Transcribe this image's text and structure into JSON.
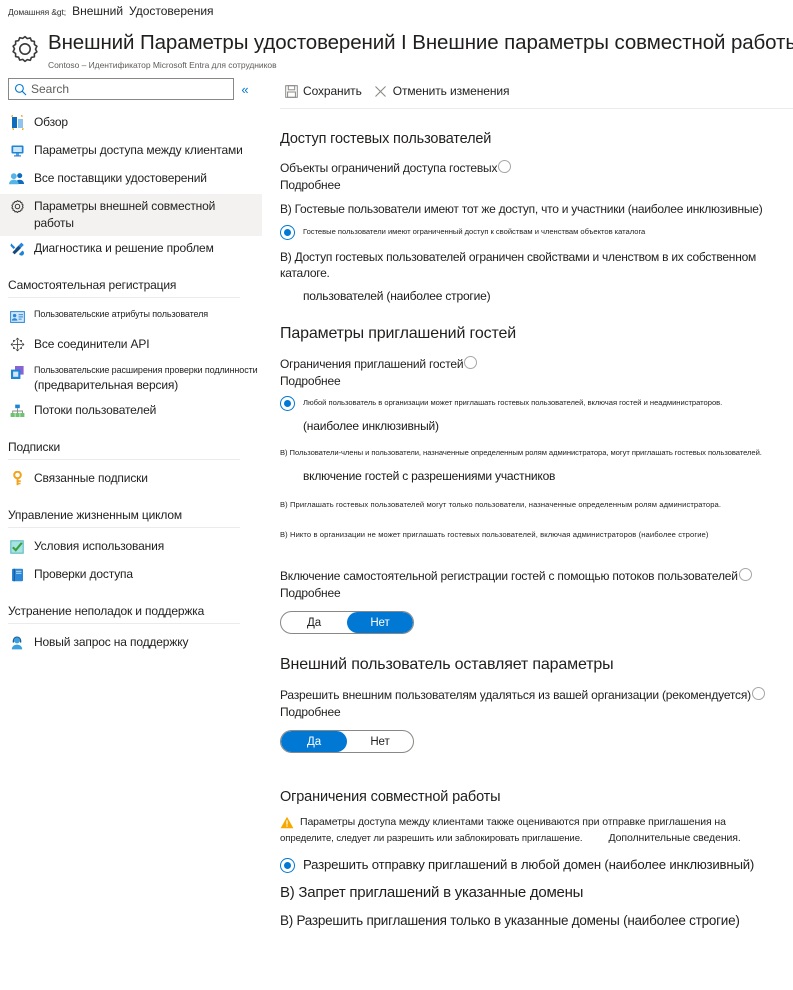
{
  "breadcrumb": {
    "home": "Домашняя &gt;",
    "items": [
      "Внешний",
      "Удостоверения"
    ]
  },
  "header": {
    "icon": "gear-icon",
    "title": "Внешний  Параметры удостоверений I Внешние параметры совместной работы",
    "subtitle": "Contoso – Идентификатор Microsoft Entra для сотрудников"
  },
  "sidebar": {
    "search": {
      "placeholder": "Search",
      "value": "",
      "icon": "search-icon"
    },
    "collapse_icon": "«",
    "items": [
      {
        "label": "Обзор",
        "icon": "overview-icon",
        "selected": false
      },
      {
        "label": "Параметры доступа между клиентами",
        "icon": "monitor-icon",
        "selected": false
      },
      {
        "label": "Все поставщики удостоверений",
        "icon": "people-icon",
        "selected": false
      },
      {
        "label": "Параметры внешней совместной работы",
        "icon": "gear-icon",
        "selected": true
      },
      {
        "label": "Диагностика и решение проблем",
        "icon": "tools-icon",
        "selected": false
      }
    ],
    "groups": [
      {
        "title": "Самостоятельная регистрация",
        "items": [
          {
            "label": "Пользовательские атрибуты пользователя",
            "icon": "id-card-icon",
            "small": true
          },
          {
            "label": "Все соединители API",
            "icon": "connector-icon",
            "small": false
          },
          {
            "label": "Пользовательские расширения проверки подлинности",
            "label2": "(предварительная версия)",
            "icon": "extension-icon",
            "small": true
          },
          {
            "label": "Потоки пользователей",
            "icon": "flow-icon",
            "small": false
          }
        ]
      },
      {
        "title": "Подписки",
        "items": [
          {
            "label": "Связанные подписки",
            "icon": "key-icon",
            "small": false
          }
        ]
      },
      {
        "title": "Управление жизненным циклом",
        "items": [
          {
            "label": "Условия использования",
            "icon": "checkbox-icon",
            "small": false
          },
          {
            "label": "Проверки доступа",
            "icon": "book-icon",
            "small": false
          }
        ]
      },
      {
        "title": "Устранение неполадок и поддержка",
        "items": [
          {
            "label": "Новый запрос на поддержку",
            "icon": "support-agent-icon",
            "small": false
          }
        ]
      }
    ]
  },
  "command_bar": {
    "save": {
      "label": "Сохранить",
      "icon": "save-icon"
    },
    "discard": {
      "label": "Отменить изменения",
      "icon": "close-icon"
    }
  },
  "sections": {
    "guest_access": {
      "heading": "Доступ гостевых пользователей",
      "field_label": "Объекты ограничений доступа гостевых",
      "learn_more": "Подробнее",
      "option_a": "B) Гостевые пользователи имеют тот же доступ, что и участники (наиболее инклюзивные)",
      "option_selected": "Гостевые пользователи имеют ограниченный доступ к свойствам и членствам объектов каталога",
      "option_c": "B) Доступ гостевых пользователей ограничен свойствами и членством в их собственном каталоге.",
      "option_c_cont": "пользователей (наиболее строгие)"
    },
    "guest_invite": {
      "heading": "Параметры приглашений гостей",
      "field_label": "Ограничения приглашений гостей",
      "learn_more": "Подробнее",
      "option_selected": "Любой пользователь в организации может приглашать гостевых пользователей, включая гостей и неадминистраторов.",
      "option_selected_cont": "(наиболее инклюзивный)",
      "option_b": "B) Пользователи-члены и пользователи, назначенные определенным ролям администратора, могут приглашать гостевых пользователей.",
      "option_b_cont": "включение гостей с разрешениями участников",
      "option_c": "B) Приглашать гостевых пользователей могут только пользователи, назначенные определенным ролям администратора.",
      "option_d": "B) Никто в организации не может приглашать гостевых пользователей, включая администраторов (наиболее строгие)"
    },
    "self_service": {
      "field_label": "Включение самостоятельной регистрации гостей с помощью потоков пользователей",
      "learn_more": "Подробнее",
      "toggle": {
        "yes": "Да",
        "no": "Нет",
        "selected": "no"
      }
    },
    "external_leave": {
      "heading": "Внешний пользователь оставляет параметры",
      "field_label": "Разрешить внешним пользователям удаляться из вашей организации (рекомендуется)",
      "learn_more": "Подробнее",
      "toggle": {
        "yes": "Да",
        "no": "Нет",
        "selected": "yes"
      }
    },
    "collab_restrictions": {
      "heading": "Ограничения совместной работы",
      "warning_line1": "Параметры доступа между клиентами также оцениваются при отправке приглашения на",
      "warning_line2": "определите, следует ли разрешить или заблокировать приглашение.",
      "warning_link": "Дополнительные сведения.",
      "option_selected": "Разрешить отправку приглашений в любой домен (наиболее инклюзивный)",
      "option_b": "B) Запрет приглашений в указанные домены",
      "option_c": "B) Разрешить приглашения только в указанные домены (наиболее строгие)"
    }
  },
  "colors": {
    "accent": "#0078d4",
    "selected_nav_bg": "#f3f2f1",
    "warning": "#f7a800",
    "text": "#201f1e"
  }
}
